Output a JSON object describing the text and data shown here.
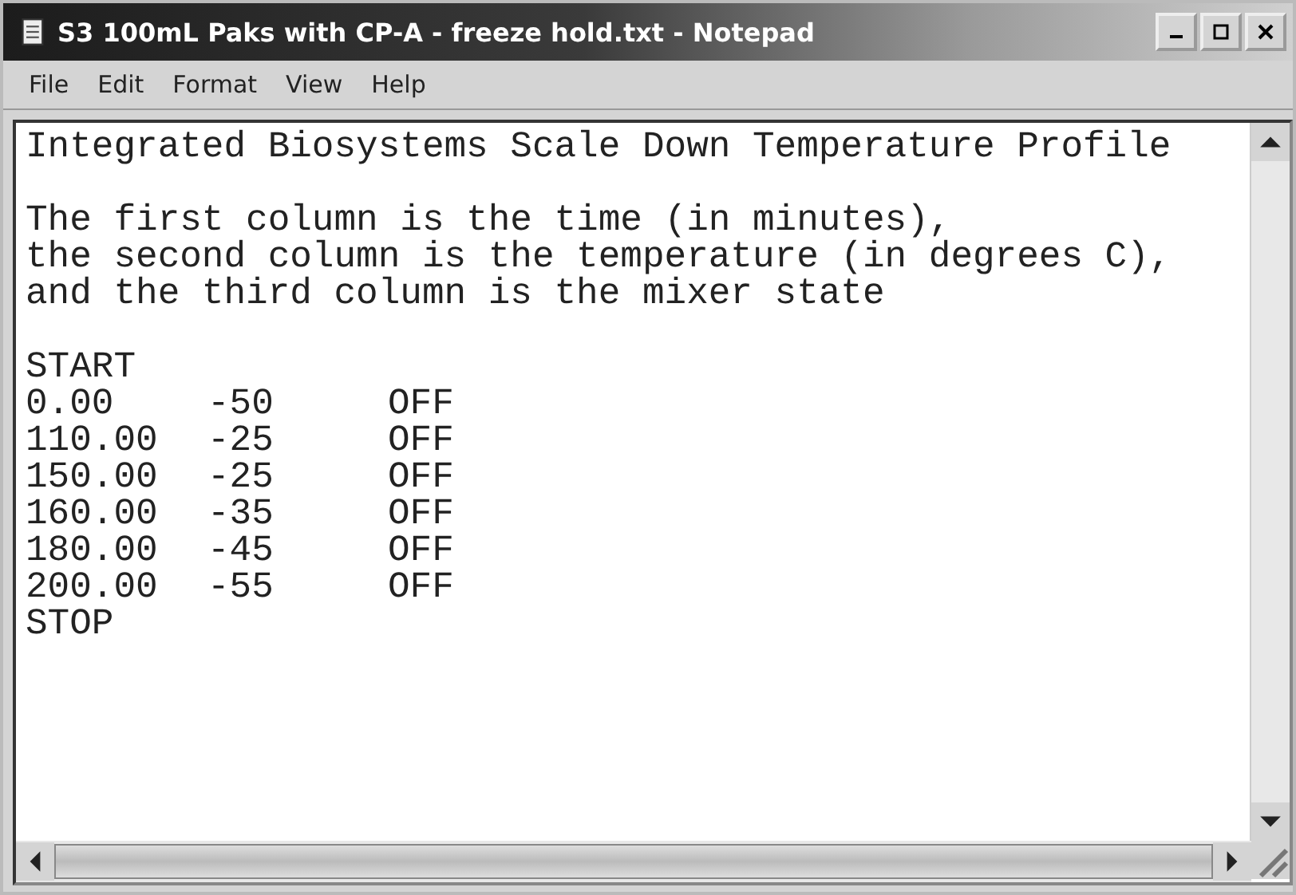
{
  "window": {
    "title": "S3 100mL Paks with CP-A - freeze hold.txt - Notepad"
  },
  "menu": [
    "File",
    "Edit",
    "Format",
    "View",
    "Help"
  ],
  "document": {
    "heading": "Integrated Biosystems Scale Down Temperature Profile",
    "description": [
      "The first column is the time (in minutes),",
      "the second column is the temperature (in degrees C),",
      "and the third column is the mixer state"
    ],
    "start": "START",
    "rows": [
      {
        "time": "0.00",
        "temperature": "-50",
        "mixer": "OFF"
      },
      {
        "time": "110.00",
        "temperature": "-25",
        "mixer": "OFF"
      },
      {
        "time": "150.00",
        "temperature": "-25",
        "mixer": "OFF"
      },
      {
        "time": "160.00",
        "temperature": "-35",
        "mixer": "OFF"
      },
      {
        "time": "180.00",
        "temperature": "-45",
        "mixer": "OFF"
      },
      {
        "time": "200.00",
        "temperature": "-55",
        "mixer": "OFF"
      }
    ],
    "stop": "STOP"
  }
}
